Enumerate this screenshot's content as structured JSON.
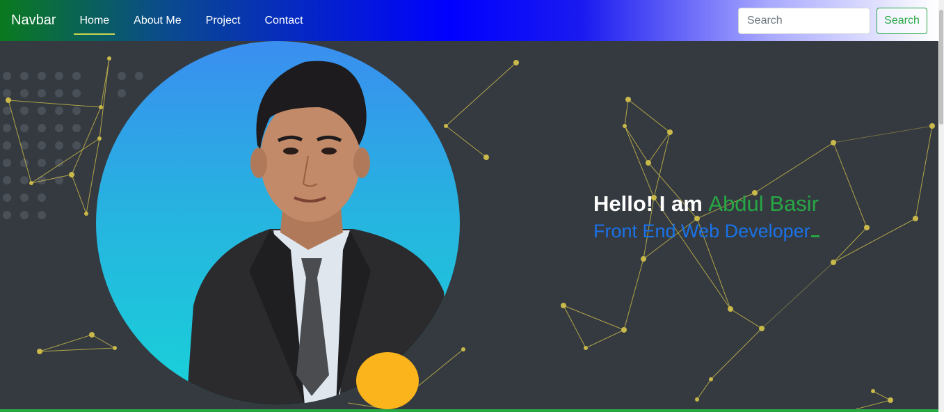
{
  "navbar": {
    "brand": "Navbar",
    "links": [
      {
        "label": "Home",
        "active": true
      },
      {
        "label": "About Me",
        "active": false
      },
      {
        "label": "Project",
        "active": false
      },
      {
        "label": "Contact",
        "active": false
      }
    ],
    "search": {
      "placeholder": "Search",
      "value": "",
      "button_label": "Search"
    }
  },
  "hero": {
    "greeting": "Hello! I am",
    "name": "Abdul Basir",
    "role": "Front End Web Developer"
  },
  "colors": {
    "accent_green": "#28a745",
    "role_blue": "#1a73e8",
    "background": "#343a40",
    "network_lines": "#c9b84a",
    "orange": "#fbb41b"
  },
  "icons": [
    "profile-photo",
    "network-background",
    "orange-semicircle"
  ]
}
